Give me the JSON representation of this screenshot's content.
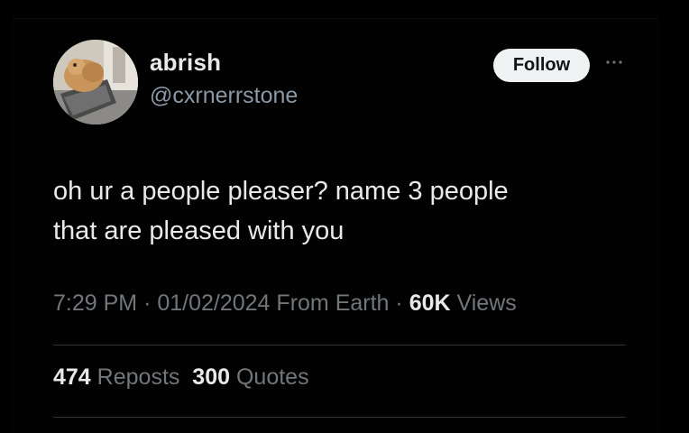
{
  "user": {
    "display_name": "abrish",
    "handle": "@cxrnerrstone"
  },
  "follow_button": {
    "label": "Follow"
  },
  "more_icon": "more-horizontal-icon",
  "tweet": {
    "text": "oh ur a people pleaser? name 3 people\nthat are pleased with you"
  },
  "meta": {
    "time": "7:29 PM",
    "separator": "·",
    "date": "01/02/2024",
    "source": "From Earth",
    "views_count": "60K",
    "views_label": "Views"
  },
  "stats": {
    "reposts_count": "474",
    "reposts_label": "Reposts",
    "quotes_count": "300",
    "quotes_label": "Quotes"
  },
  "colors": {
    "background": "#000000",
    "primary_text": "#e7e9ea",
    "secondary_text": "#71767b",
    "follow_bg": "#eff3f4",
    "divider": "#2f3336"
  }
}
